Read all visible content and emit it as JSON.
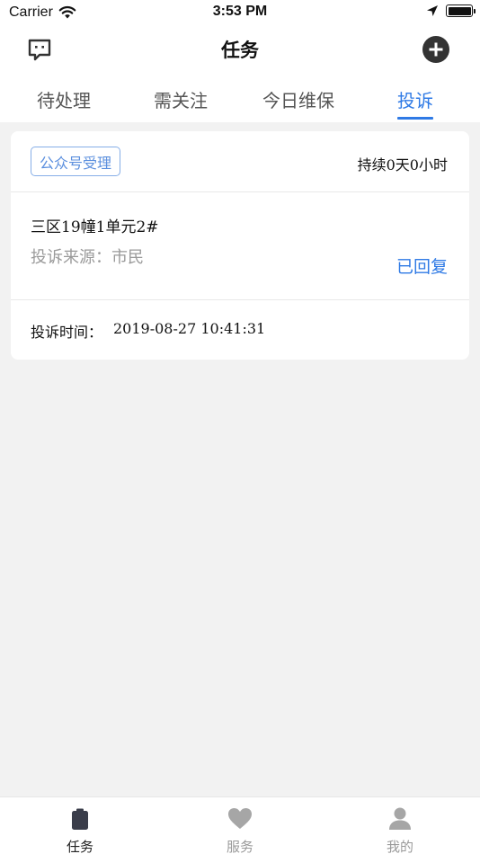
{
  "status_bar": {
    "carrier": "Carrier",
    "time": "3:53 PM"
  },
  "nav": {
    "title": "任务",
    "left_icon": "message-icon",
    "right_icon": "add-circle-icon"
  },
  "tabs": [
    {
      "label": "待处理",
      "active": false
    },
    {
      "label": "需关注",
      "active": false
    },
    {
      "label": "今日维保",
      "active": false
    },
    {
      "label": "投诉",
      "active": true
    }
  ],
  "complaint_card": {
    "channel_tag": "公众号受理",
    "duration": "持续0天0小时",
    "address": "三区19幢1单元2#",
    "source": "投诉来源：市民",
    "status": "已回复",
    "time_label": "投诉时间：",
    "time_value": "2019-08-27 10:41:31"
  },
  "tab_bar": [
    {
      "label": "任务",
      "icon": "clipboard-icon",
      "active": true
    },
    {
      "label": "服务",
      "icon": "heart-icon",
      "active": false
    },
    {
      "label": "我的",
      "icon": "person-icon",
      "active": false
    }
  ],
  "colors": {
    "accent": "#2f7ae5",
    "background": "#f2f2f2",
    "tag_border": "#86aee7"
  }
}
